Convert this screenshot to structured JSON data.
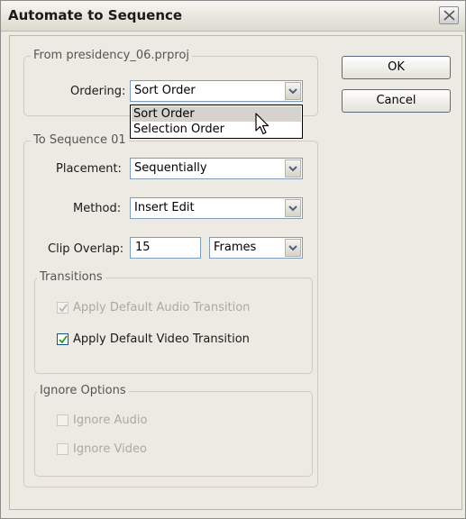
{
  "window": {
    "title": "Automate to Sequence"
  },
  "from_group": {
    "legend": "From presidency_06.prproj",
    "ordering_label": "Ordering:",
    "ordering_value": "Sort Order",
    "ordering_options": [
      "Sort Order",
      "Selection Order"
    ]
  },
  "to_group": {
    "legend": "To Sequence 01",
    "placement_label": "Placement:",
    "placement_value": "Sequentially",
    "method_label": "Method:",
    "method_value": "Insert Edit",
    "clip_overlap_label": "Clip Overlap:",
    "clip_overlap_value": "15",
    "clip_overlap_unit": "Frames"
  },
  "transitions": {
    "legend": "Transitions",
    "audio_label": "Apply Default Audio Transition",
    "audio_checked": true,
    "audio_enabled": false,
    "video_label": "Apply Default Video Transition",
    "video_checked": true,
    "video_enabled": true
  },
  "ignore_options": {
    "legend": "Ignore Options",
    "audio_label": "Ignore Audio",
    "audio_checked": false,
    "video_label": "Ignore Video",
    "video_checked": false
  },
  "buttons": {
    "ok": "OK",
    "cancel": "Cancel"
  },
  "icons": {
    "close": "close-icon",
    "dropdown": "chevron-down-icon",
    "check": "check-icon",
    "cursor": "mouse-pointer-icon"
  }
}
